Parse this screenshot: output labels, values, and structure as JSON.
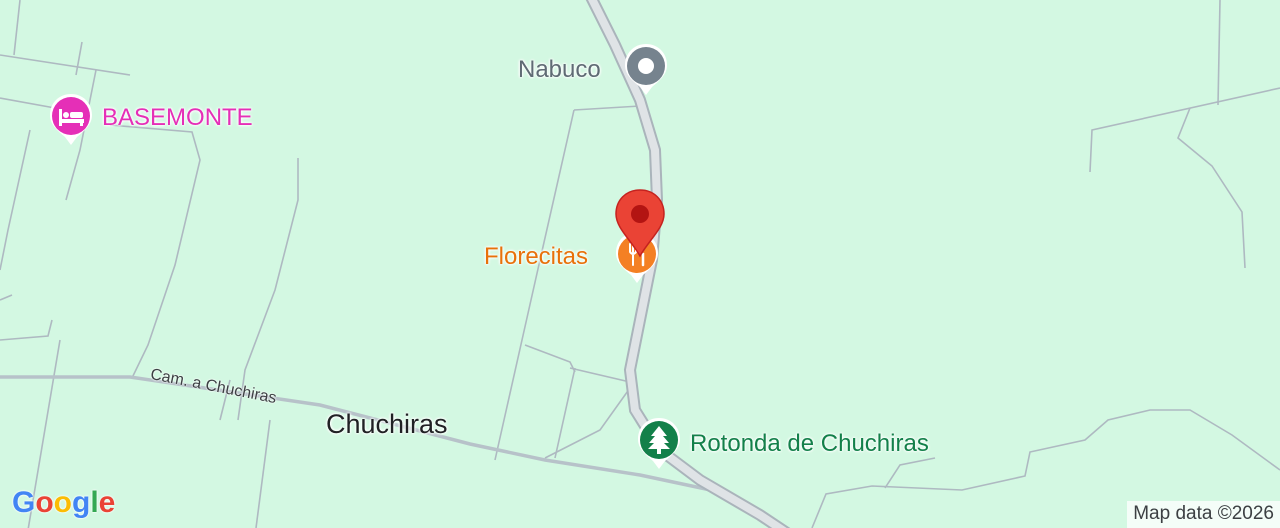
{
  "map": {
    "background_color": "#d3f8e2",
    "road_color": "#c4ccd0",
    "track_color": "#a8b4bc",
    "pois": [
      {
        "name": "Nabuco",
        "icon": "location-dot-icon",
        "color": "#5f6b74"
      },
      {
        "name": "BASEMONTE",
        "icon": "bed-icon",
        "color": "#e52fb7"
      },
      {
        "name": "Florecitas",
        "icon": "fork-knife-icon",
        "color": "#e8710a"
      },
      {
        "name": "Rotonda de Chuchiras",
        "icon": "tree-icon",
        "color": "#13804a"
      }
    ],
    "place_label": "Chuchiras",
    "road_label": "Cam. a Chuchiras",
    "selected_marker": {
      "icon": "map-pin-icon",
      "color": "#ea4335"
    },
    "logo": {
      "letters": [
        "G",
        "o",
        "o",
        "g",
        "l",
        "e"
      ],
      "colors": [
        "#4285f4",
        "#ea4335",
        "#fbbc04",
        "#4285f4",
        "#34a853",
        "#ea4335"
      ]
    },
    "attribution": "Map data ©2026"
  }
}
